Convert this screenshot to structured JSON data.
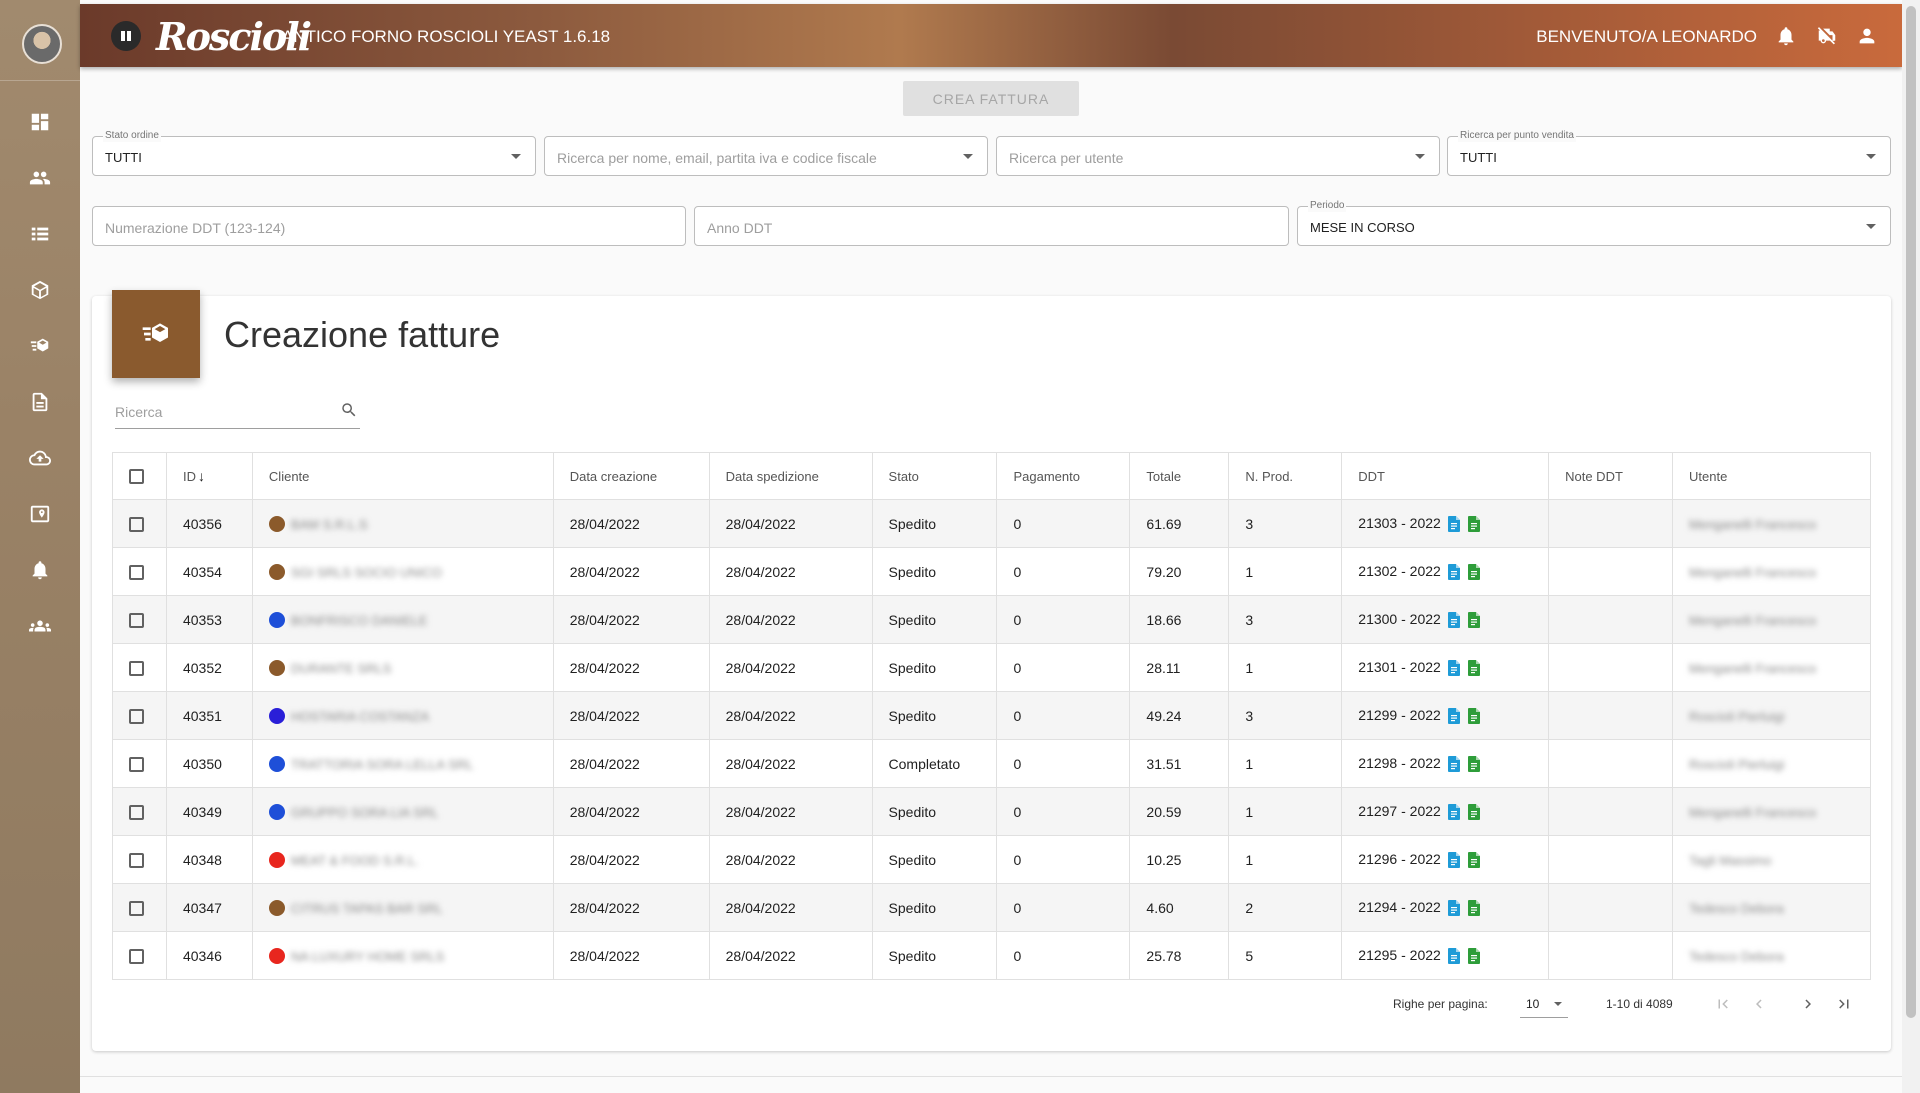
{
  "header": {
    "logo": "Roscioli",
    "app_title": "ANTICO FORNO ROSCIOLI YEAST 1.6.18",
    "welcome": "BENVENUTO/A LEONARDO"
  },
  "sidebar": {
    "items": [
      {
        "icon": "dashboard-icon"
      },
      {
        "icon": "people-icon"
      },
      {
        "icon": "list-icon"
      },
      {
        "icon": "package-icon"
      },
      {
        "icon": "shipping-list-icon"
      },
      {
        "icon": "document-icon"
      },
      {
        "icon": "cloud-upload-icon"
      },
      {
        "icon": "map-icon"
      },
      {
        "icon": "bell-icon"
      },
      {
        "icon": "groups-icon"
      }
    ]
  },
  "actions": {
    "crea_fattura": "CREA FATTURA"
  },
  "filters": {
    "stato_ordine": {
      "label": "Stato ordine",
      "value": "TUTTI"
    },
    "ricerca_cliente": {
      "placeholder": "Ricerca per nome, email, partita iva e codice fiscale"
    },
    "ricerca_utente": {
      "placeholder": "Ricerca per utente"
    },
    "punto_vendita": {
      "label": "Ricerca per punto vendita",
      "value": "TUTTI"
    },
    "numerazione_ddt": {
      "placeholder": "Numerazione DDT (123-124)"
    },
    "anno_ddt": {
      "placeholder": "Anno DDT"
    },
    "periodo": {
      "label": "Periodo",
      "value": "MESE IN CORSO"
    }
  },
  "card": {
    "title": "Creazione fatture",
    "search_placeholder": "Ricerca"
  },
  "table": {
    "columns": {
      "id": "ID",
      "cliente": "Cliente",
      "data_creazione": "Data creazione",
      "data_spedizione": "Data spedizione",
      "stato": "Stato",
      "pagamento": "Pagamento",
      "totale": "Totale",
      "n_prod": "N. Prod.",
      "ddt": "DDT",
      "note_ddt": "Note DDT",
      "utente": "Utente"
    },
    "rows": [
      {
        "id": "40356",
        "color": "#8b5a2b",
        "cliente": "BAM S.R.L.S",
        "data_creazione": "28/04/2022",
        "data_spedizione": "28/04/2022",
        "stato": "Spedito",
        "pagamento": "0",
        "totale": "61.69",
        "n_prod": "3",
        "ddt": "21303 - 2022",
        "note_ddt": "",
        "utente": "Menganelli Francesco"
      },
      {
        "id": "40354",
        "color": "#8b5a2b",
        "cliente": "SGI SRLS SOCIO UNICO",
        "data_creazione": "28/04/2022",
        "data_spedizione": "28/04/2022",
        "stato": "Spedito",
        "pagamento": "0",
        "totale": "79.20",
        "n_prod": "1",
        "ddt": "21302 - 2022",
        "note_ddt": "",
        "utente": "Menganelli Francesco"
      },
      {
        "id": "40353",
        "color": "#1e4fd8",
        "cliente": "BONFRISCO DANIELE",
        "data_creazione": "28/04/2022",
        "data_spedizione": "28/04/2022",
        "stato": "Spedito",
        "pagamento": "0",
        "totale": "18.66",
        "n_prod": "3",
        "ddt": "21300 - 2022",
        "note_ddt": "",
        "utente": "Menganelli Francesco"
      },
      {
        "id": "40352",
        "color": "#8b5a2b",
        "cliente": "DURANTE SRLS",
        "data_creazione": "28/04/2022",
        "data_spedizione": "28/04/2022",
        "stato": "Spedito",
        "pagamento": "0",
        "totale": "28.11",
        "n_prod": "1",
        "ddt": "21301 - 2022",
        "note_ddt": "",
        "utente": "Menganelli Francesco"
      },
      {
        "id": "40351",
        "color": "#2a1fd8",
        "cliente": "HOSTARIA COSTANZA",
        "data_creazione": "28/04/2022",
        "data_spedizione": "28/04/2022",
        "stato": "Spedito",
        "pagamento": "0",
        "totale": "49.24",
        "n_prod": "3",
        "ddt": "21299 - 2022",
        "note_ddt": "",
        "utente": "Roscioli Pierluigi"
      },
      {
        "id": "40350",
        "color": "#1e4fd8",
        "cliente": "TRATTORIA SORA LELLA SRL",
        "data_creazione": "28/04/2022",
        "data_spedizione": "28/04/2022",
        "stato": "Completato",
        "pagamento": "0",
        "totale": "31.51",
        "n_prod": "1",
        "ddt": "21298 - 2022",
        "note_ddt": "",
        "utente": "Roscioli Pierluigi"
      },
      {
        "id": "40349",
        "color": "#1e4fd8",
        "cliente": "GRUPPO SORA LIA SRL",
        "data_creazione": "28/04/2022",
        "data_spedizione": "28/04/2022",
        "stato": "Spedito",
        "pagamento": "0",
        "totale": "20.59",
        "n_prod": "1",
        "ddt": "21297 - 2022",
        "note_ddt": "",
        "utente": "Menganelli Francesco"
      },
      {
        "id": "40348",
        "color": "#e8261e",
        "cliente": "MEAT & FOOD S.R.L.",
        "data_creazione": "28/04/2022",
        "data_spedizione": "28/04/2022",
        "stato": "Spedito",
        "pagamento": "0",
        "totale": "10.25",
        "n_prod": "1",
        "ddt": "21296 - 2022",
        "note_ddt": "",
        "utente": "Tagli Massimo"
      },
      {
        "id": "40347",
        "color": "#8b5a2b",
        "cliente": "CITRUS TAPAS BAR SRL",
        "data_creazione": "28/04/2022",
        "data_spedizione": "28/04/2022",
        "stato": "Spedito",
        "pagamento": "0",
        "totale": "4.60",
        "n_prod": "2",
        "ddt": "21294 - 2022",
        "note_ddt": "",
        "utente": "Tedesco Debora"
      },
      {
        "id": "40346",
        "color": "#e8261e",
        "cliente": "NA LUXURY HOME SRLS",
        "data_creazione": "28/04/2022",
        "data_spedizione": "28/04/2022",
        "stato": "Spedito",
        "pagamento": "0",
        "totale": "25.78",
        "n_prod": "5",
        "ddt": "21295 - 2022",
        "note_ddt": "",
        "utente": "Tedesco Debora"
      }
    ]
  },
  "pagination": {
    "rows_label": "Righe per pagina:",
    "rows_value": "10",
    "range": "1-10 di 4089"
  },
  "colors": {
    "accent": "#8a5a2e",
    "doc_icon_blue": "#1e9bd7",
    "doc_icon_green": "#2e9d3a"
  }
}
